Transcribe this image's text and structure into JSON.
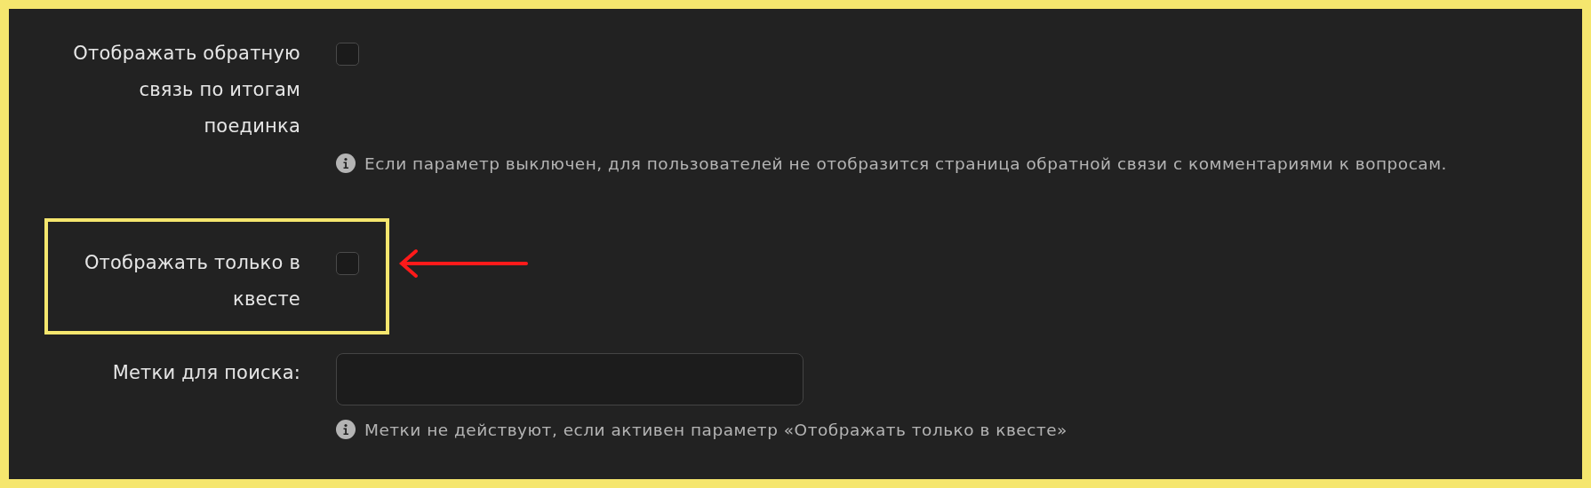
{
  "settings": [
    {
      "kind": "checkbox",
      "label": "Отображать обратную связь по итогам поединка",
      "checked": false,
      "highlighted": false,
      "hint": "Если параметр выключен, для пользователей не отобразится страница обратной связи с комментариями к вопросам."
    },
    {
      "kind": "checkbox",
      "label": "Отображать только в квесте",
      "checked": false,
      "highlighted": true
    },
    {
      "kind": "text",
      "label": "Метки для поиска:",
      "hint": "Метки не действуют, если активен параметр «Отображать только в квесте»"
    }
  ]
}
